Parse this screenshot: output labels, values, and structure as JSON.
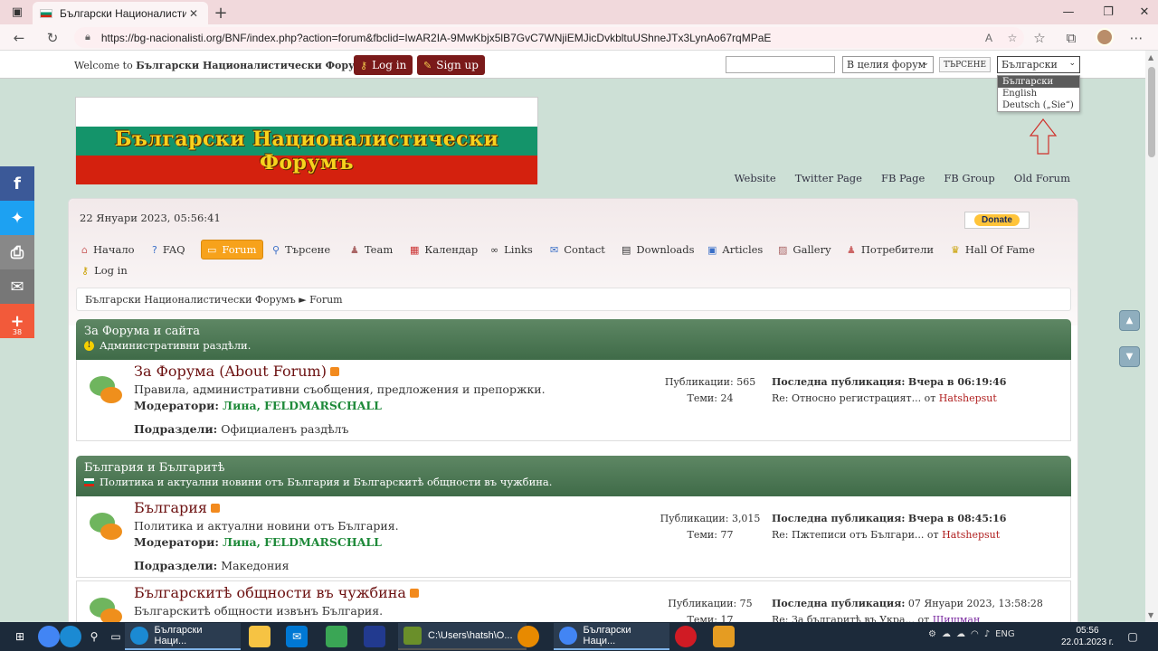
{
  "browser": {
    "tab_title": "Български Националистическ",
    "url": "https://bg-nacionalisti.org/BNF/index.php?action=forum&fbclid=IwAR2IA-9MwKbjx5lB7GvC7WNjiEMJicDvkbltuUShneJTx3LynAo67rqMPaE"
  },
  "top": {
    "welcome_prefix": "Welcome to",
    "welcome_site": "Български Националистически Форумъ.",
    "login": "Log in",
    "signup": "Sign up",
    "scope_selected": "В целия форум",
    "search_button": "ТЪРСЕНЕ",
    "lang_selected": "Български",
    "lang_options": [
      "Български",
      "English",
      "Deutsch („Sie“)"
    ]
  },
  "banner_text": "Български Националистически Форумъ",
  "toplinks": [
    "Website",
    "Twitter Page",
    "FB Page",
    "FB Group",
    "Old Forum"
  ],
  "date": "22 Януари 2023, 05:56:41",
  "donate": "Donate",
  "menu": [
    "Начало",
    "FAQ",
    "Forum",
    "Търсене",
    "Team",
    "Календар",
    "Links",
    "Contact",
    "Downloads",
    "Articles",
    "Gallery",
    "Потребители",
    "Hall Of Fame",
    "Log in"
  ],
  "breadcrumb": "Български Националистически Форумъ ► Forum",
  "categories": [
    {
      "title": "За Форума и сайта",
      "desc": "Административни раздѣли.",
      "board": {
        "name": "За Форума (About Forum)",
        "desc": "Правила, административни съобщения, предложения и препоржки.",
        "mods_label": "Модератори:",
        "mod1": "Лина,",
        "mod2": "FELDMARSCHALL",
        "sub_label": "Подраздели:",
        "sub": "Официаленъ раздѣлъ",
        "posts": "Публикации: 565",
        "topics": "Теми: 24",
        "last_label": "Последна публикация:",
        "last_when": "Вчера в 06:19:46",
        "last_topic": "Re: Относно регистрацият...",
        "from": "от",
        "last_user": "Hatshepsut"
      }
    },
    {
      "title": "България и Българитѣ",
      "desc": "Политика и актуални новини отъ България и Българскитѣ общности въ чужбина.",
      "board": {
        "name": "България",
        "desc": "Политика и актуални новини отъ България.",
        "mods_label": "Модератори:",
        "mod1": "Лина,",
        "mod2": "FELDMARSCHALL",
        "sub_label": "Подраздели:",
        "sub": "Македония",
        "posts": "Публикации: 3,015",
        "topics": "Теми: 77",
        "last_label": "Последна публикация:",
        "last_when": "Вчера в 08:45:16",
        "last_topic": "Re: Пжтеписи отъ Българи...",
        "from": "от",
        "last_user": "Hatshepsut"
      },
      "board2": {
        "name": "Българскитѣ общности въ чужбина",
        "desc": "Българскитѣ общности извънъ България.",
        "posts": "Публикации: 75",
        "topics": "Теми: 17",
        "last_label": "Последна публикация:",
        "last_when": "07 Януари 2023, 13:58:28",
        "last_topic": "Re: За българитѣ въ Укра...",
        "from": "от",
        "last_user": "Шишман"
      }
    }
  ],
  "share_count": "38",
  "taskbar": {
    "app1": "Български Наци...",
    "app2": "C:\\Users\\hatsh\\O...",
    "app3": "Български Наци...",
    "lang": "ENG",
    "time": "05:56",
    "date": "22.01.2023 г."
  }
}
